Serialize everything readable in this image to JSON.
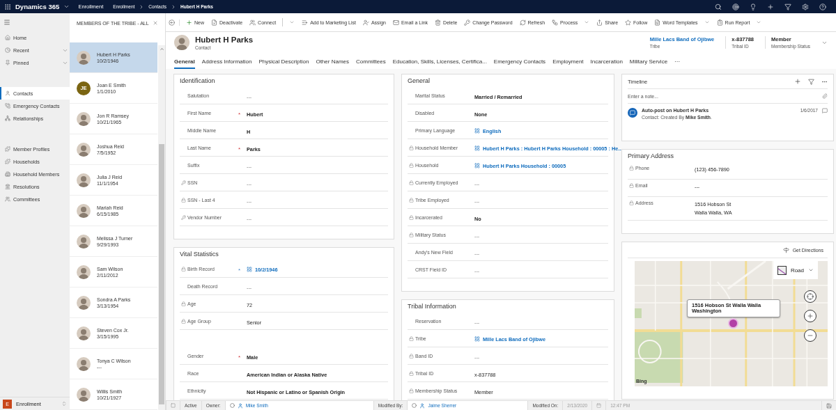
{
  "top_bar": {
    "app_name": "Dynamics 365",
    "area": "Enrollment",
    "breadcrumb": [
      "Enrollment",
      "Contacts",
      "Hubert H Parks"
    ]
  },
  "nav": {
    "groups": [
      {
        "items": [
          {
            "label": "Home",
            "selected": false,
            "expandable": false
          },
          {
            "label": "Recent",
            "selected": false,
            "expandable": true
          },
          {
            "label": "Pinned",
            "selected": false,
            "expandable": true
          }
        ]
      },
      {
        "items": [
          {
            "label": "Contacts",
            "selected": true,
            "expandable": false
          },
          {
            "label": "Emergency Contacts",
            "selected": false,
            "expandable": false
          },
          {
            "label": "Relationships",
            "selected": false,
            "expandable": false
          }
        ]
      },
      {
        "items": [
          {
            "label": "Member Profiles",
            "selected": false,
            "expandable": false
          },
          {
            "label": "Households",
            "selected": false,
            "expandable": false
          },
          {
            "label": "Household Members",
            "selected": false,
            "expandable": false
          },
          {
            "label": "Resolutions",
            "selected": false,
            "expandable": false
          },
          {
            "label": "Committees",
            "selected": false,
            "expandable": false
          }
        ]
      }
    ],
    "area_switcher": {
      "initial": "E",
      "label": "Enrollment"
    }
  },
  "list": {
    "title": "MEMBERS OF THE TRIBE - ALL",
    "items": [
      {
        "name": "Hubert H Parks",
        "date": "10/2/1946",
        "selected": true
      },
      {
        "name": "Joan E Smith",
        "date": "1/1/2010",
        "selected": false,
        "avatar": {
          "kind": "initials",
          "initials": "JE",
          "color": "#7b6512"
        }
      },
      {
        "name": "Jon R Ramsey",
        "date": "10/21/1965",
        "selected": false
      },
      {
        "name": "Joshua Reid",
        "date": "7/5/1952",
        "selected": false
      },
      {
        "name": "Julia J Reid",
        "date": "11/1/1954",
        "selected": false
      },
      {
        "name": "Mariah Reid",
        "date": "6/15/1985",
        "selected": false
      },
      {
        "name": "Melissa J Turner",
        "date": "9/29/1993",
        "selected": false
      },
      {
        "name": "Sam Wilson",
        "date": "2/11/2012",
        "selected": false
      },
      {
        "name": "Sondra A Parks",
        "date": "3/13/1954",
        "selected": false
      },
      {
        "name": "Steven Cox Jr.",
        "date": "3/15/1995",
        "selected": false
      },
      {
        "name": "Tonya C Wilson",
        "date": "---",
        "selected": false
      },
      {
        "name": "Willis Smith",
        "date": "10/21/1927",
        "selected": false
      }
    ]
  },
  "commands": [
    {
      "label": "New",
      "has_menu": false,
      "split": false
    },
    {
      "label": "Deactivate",
      "has_menu": false,
      "split": false
    },
    {
      "label": "Connect",
      "has_menu": true,
      "split": true
    },
    {
      "label": "Add to Marketing List",
      "has_menu": false,
      "split": false
    },
    {
      "label": "Assign",
      "has_menu": false,
      "split": false
    },
    {
      "label": "Email a Link",
      "has_menu": false,
      "split": false
    },
    {
      "label": "Delete",
      "has_menu": false,
      "split": false
    },
    {
      "label": "Change Password",
      "has_menu": false,
      "split": false
    },
    {
      "label": "Refresh",
      "has_menu": false,
      "split": false
    },
    {
      "label": "Process",
      "has_menu": true,
      "split": false
    },
    {
      "label": "Share",
      "has_menu": false,
      "split": false
    },
    {
      "label": "Follow",
      "has_menu": false,
      "split": false
    },
    {
      "label": "Word Templates",
      "has_menu": true,
      "split": false
    },
    {
      "label": "Run Report",
      "has_menu": true,
      "split": false
    }
  ],
  "record": {
    "name": "Hubert H Parks",
    "entity": "Contact",
    "header_fields": [
      {
        "value": "Mille Lacs Band of Ojibwe",
        "label": "Tribe",
        "kind": "link"
      },
      {
        "value": "x-837788",
        "label": "Tribal ID",
        "kind": "text"
      },
      {
        "value": "Member",
        "label": "Membership Status",
        "kind": "text"
      }
    ]
  },
  "tabs": [
    {
      "label": "General",
      "selected": true
    },
    {
      "label": "Address Information",
      "selected": false
    },
    {
      "label": "Physical Description",
      "selected": false
    },
    {
      "label": "Other Names",
      "selected": false
    },
    {
      "label": "Committees",
      "selected": false
    },
    {
      "label": "Education, Skills, Licenses, Certifica...",
      "selected": false
    },
    {
      "label": "Emergency Contacts",
      "selected": false
    },
    {
      "label": "Employment",
      "selected": false
    },
    {
      "label": "Incarceration",
      "selected": false
    },
    {
      "label": "Military Service",
      "selected": false
    },
    {
      "label": "···",
      "selected": false
    }
  ],
  "columns": [
    [
      {
        "title": "Identification",
        "groups": [
          [
            {
              "label": "Salutation",
              "value": "---",
              "kind": "empty",
              "bold": false,
              "locked": false,
              "secured": false
            },
            {
              "label": "First Name",
              "value": "Hubert",
              "kind": "text",
              "bold": true,
              "locked": false,
              "secured": false,
              "marker": "*",
              "recommended": false
            },
            {
              "label": "Middle Name",
              "value": "H",
              "kind": "text",
              "bold": true,
              "locked": false,
              "secured": false
            },
            {
              "label": "Last Name",
              "value": "Parks",
              "kind": "text",
              "bold": true,
              "locked": false,
              "secured": false,
              "marker": "*",
              "recommended": false
            },
            {
              "label": "Suffix",
              "value": "---",
              "kind": "empty",
              "bold": false,
              "locked": false,
              "secured": false
            },
            {
              "label": "SSN",
              "value": "---",
              "kind": "empty",
              "bold": false,
              "locked": false,
              "secured": true
            },
            {
              "label": "SSN - Last 4",
              "value": "---",
              "kind": "empty",
              "bold": false,
              "locked": true,
              "secured": false
            },
            {
              "label": "Vendor Number",
              "value": "---",
              "kind": "empty",
              "bold": false,
              "locked": false,
              "secured": true
            }
          ]
        ]
      },
      {
        "title": "Vital Statistics",
        "groups": [
          [
            {
              "label": "Birth Record",
              "value": "10/2/1946",
              "kind": "link",
              "bold": true,
              "locked": true,
              "secured": false,
              "marker": "*",
              "recommended": true
            },
            {
              "label": "Death Record",
              "value": "---",
              "kind": "empty",
              "bold": false,
              "locked": false,
              "secured": false
            },
            {
              "label": "Age",
              "value": "72",
              "kind": "text",
              "bold": false,
              "locked": true,
              "secured": false
            },
            {
              "label": "Age Group",
              "value": "Senior",
              "kind": "text",
              "bold": false,
              "locked": true,
              "secured": false
            }
          ],
          [
            {
              "label": "Gender",
              "value": "Male",
              "kind": "text",
              "bold": true,
              "locked": false,
              "secured": false,
              "marker": "*",
              "recommended": false
            },
            {
              "label": "Race",
              "value": "American Indian or Alaska Native",
              "kind": "text",
              "bold": true,
              "locked": false,
              "secured": false
            },
            {
              "label": "Ethnicity",
              "value": "Not Hispanic or Latino or Spanish Origin",
              "kind": "text",
              "bold": true,
              "locked": false,
              "secured": false
            }
          ]
        ]
      }
    ],
    [
      {
        "title": "General",
        "groups": [
          [
            {
              "label": "Marital Status",
              "value": "Married / Remarried",
              "kind": "text",
              "bold": true,
              "locked": false,
              "secured": false
            },
            {
              "label": "Disabled",
              "value": "None",
              "kind": "text",
              "bold": true,
              "locked": false,
              "secured": false
            },
            {
              "label": "Primary Language",
              "value": "English",
              "kind": "link",
              "bold": true,
              "locked": false,
              "secured": false
            },
            {
              "label": "Household Member",
              "value": "Hubert H Parks : Hubert H Parks Household : 00005 : He...",
              "kind": "link",
              "bold": true,
              "locked": true,
              "secured": false
            },
            {
              "label": "Household",
              "value": "Hubert H Parks Household : 00005",
              "kind": "link",
              "bold": true,
              "locked": true,
              "secured": false
            },
            {
              "label": "Currently Employed",
              "value": "---",
              "kind": "empty",
              "bold": false,
              "locked": true,
              "secured": false
            },
            {
              "label": "Tribe Employed",
              "value": "---",
              "kind": "empty",
              "bold": false,
              "locked": true,
              "secured": false
            },
            {
              "label": "Incarcerated",
              "value": "No",
              "kind": "text",
              "bold": true,
              "locked": true,
              "secured": false
            },
            {
              "label": "Military Status",
              "value": "---",
              "kind": "empty",
              "bold": false,
              "locked": true,
              "secured": false
            },
            {
              "label": "Andy's New Field",
              "value": "---",
              "kind": "empty",
              "bold": false,
              "locked": false,
              "secured": false
            },
            {
              "label": "CRST Field ID",
              "value": "---",
              "kind": "empty",
              "bold": false,
              "locked": false,
              "secured": false
            }
          ]
        ]
      },
      {
        "title": "Tribal Information",
        "groups": [
          [
            {
              "label": "Reservation",
              "value": "---",
              "kind": "empty",
              "bold": false,
              "locked": false,
              "secured": false
            },
            {
              "label": "Tribe",
              "value": "Mille Lacs Band of Ojibwe",
              "kind": "link",
              "bold": true,
              "locked": true,
              "secured": false
            },
            {
              "label": "Band ID",
              "value": "---",
              "kind": "empty",
              "bold": false,
              "locked": true,
              "secured": false
            },
            {
              "label": "Tribal ID",
              "value": "x-837788",
              "kind": "text",
              "bold": false,
              "locked": true,
              "secured": false
            },
            {
              "label": "Membership Status",
              "value": "Member",
              "kind": "text",
              "bold": false,
              "locked": true,
              "secured": false
            }
          ]
        ]
      }
    ]
  ],
  "timeline": {
    "title": "Timeline",
    "note_placeholder": "Enter a note...",
    "entries": [
      {
        "title": "Auto-post on Hubert H Parks",
        "detail": "Contact: Created By **Mike Smith**.",
        "date": "1/6/2017"
      }
    ]
  },
  "primary_address": {
    "title": "Primary Address",
    "rows": [
      {
        "label": "Phone",
        "value": "(123) 456-7890"
      },
      {
        "label": "Email",
        "value": "---"
      },
      {
        "label": "Address",
        "value": "1516 Hobson St\nWalla Walla, WA"
      }
    ]
  },
  "map": {
    "directions": "Get Directions",
    "popup": "1516 Hobson St Walla Walla Washington",
    "style": "Road",
    "provider": "Bing"
  },
  "status_bar": {
    "status": "Active",
    "fields": [
      {
        "label": "Owner:",
        "value": "Mike Smith",
        "kind": "user"
      },
      {
        "label": "Modified By:",
        "value": "Jaime Sherrer",
        "kind": "user"
      },
      {
        "label": "Modified On:",
        "value": "2/13/2020",
        "kind": "date",
        "time": "12:47 PM"
      }
    ]
  }
}
